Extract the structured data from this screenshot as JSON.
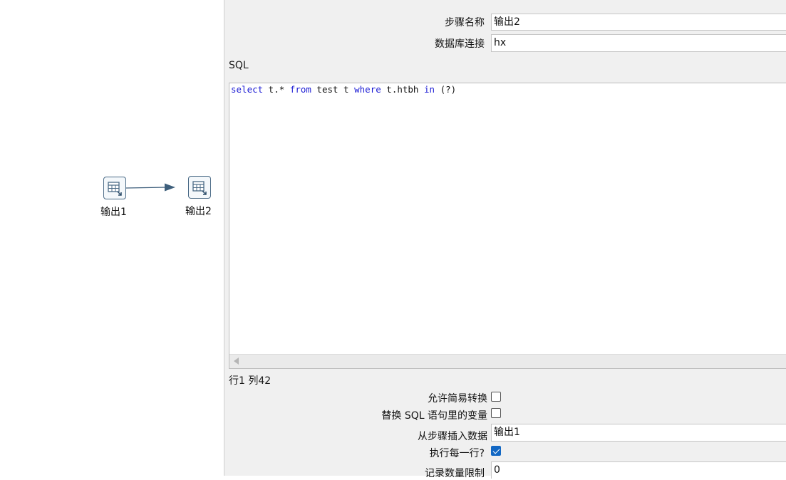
{
  "canvas": {
    "steps": [
      {
        "label": "输出1"
      },
      {
        "label": "输出2"
      }
    ]
  },
  "dialog": {
    "step_name_label": "步骤名称",
    "step_name_value": "输出2",
    "connection_label": "数据库连接",
    "connection_value": "hx",
    "sql_label": "SQL",
    "sql_tokens": [
      {
        "t": "select",
        "kw": true
      },
      {
        "t": " t.* ",
        "kw": false
      },
      {
        "t": "from",
        "kw": true
      },
      {
        "t": " test t ",
        "kw": false
      },
      {
        "t": "where",
        "kw": true
      },
      {
        "t": " t.htbh ",
        "kw": false
      },
      {
        "t": "in",
        "kw": true
      },
      {
        "t": " (?)",
        "kw": false
      }
    ],
    "cursor_position": "行1 列42",
    "lazy_conversion_label": "允许简易转换",
    "lazy_conversion_checked": false,
    "replace_vars_label": "替换 SQL 语句里的变量",
    "replace_vars_checked": false,
    "insert_from_step_label": "从步骤插入数据",
    "insert_from_step_value": "输出1",
    "execute_each_row_label": "执行每一行?",
    "execute_each_row_checked": true,
    "limit_label": "记录数量限制",
    "limit_value": "0"
  },
  "colors": {
    "keyword": "#1a1ad4",
    "hop": "#3e5f7c",
    "checkbox_checked": "#1368c4"
  }
}
